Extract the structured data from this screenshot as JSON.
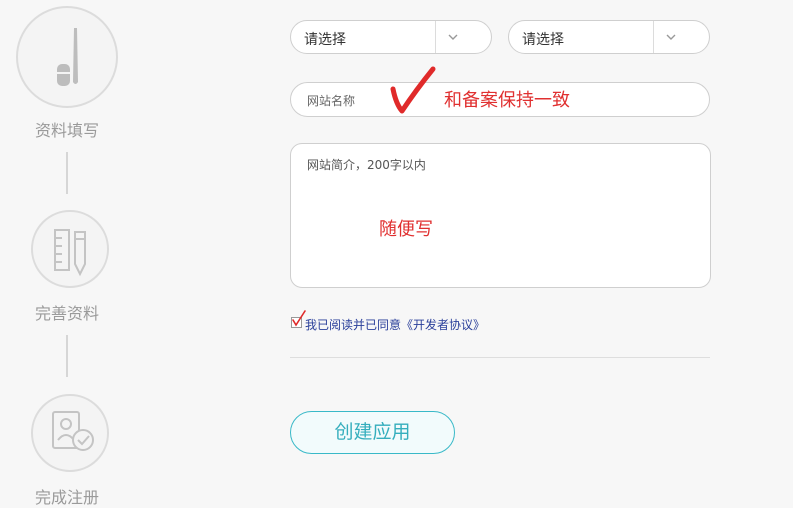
{
  "steps": [
    {
      "label": "资料填写",
      "icon": "pen-icon"
    },
    {
      "label": "完善资料",
      "icon": "ruler-pencil-icon"
    },
    {
      "label": "完成注册",
      "icon": "certificate-check-icon"
    }
  ],
  "form": {
    "select1": {
      "value": "请选择"
    },
    "select2": {
      "value": "请选择"
    },
    "site_name": {
      "placeholder": "网站名称",
      "annotation": "和备案保持一致"
    },
    "site_intro": {
      "placeholder": "网站简介，200字以内",
      "annotation": "随便写"
    },
    "agreement": {
      "text": "我已阅读并已同意《开发者协议》",
      "checked": true
    },
    "create_button": "创建应用"
  },
  "colors": {
    "accent": "#39b9c8",
    "annotation": "#e03030",
    "link": "#2a3f9a"
  }
}
